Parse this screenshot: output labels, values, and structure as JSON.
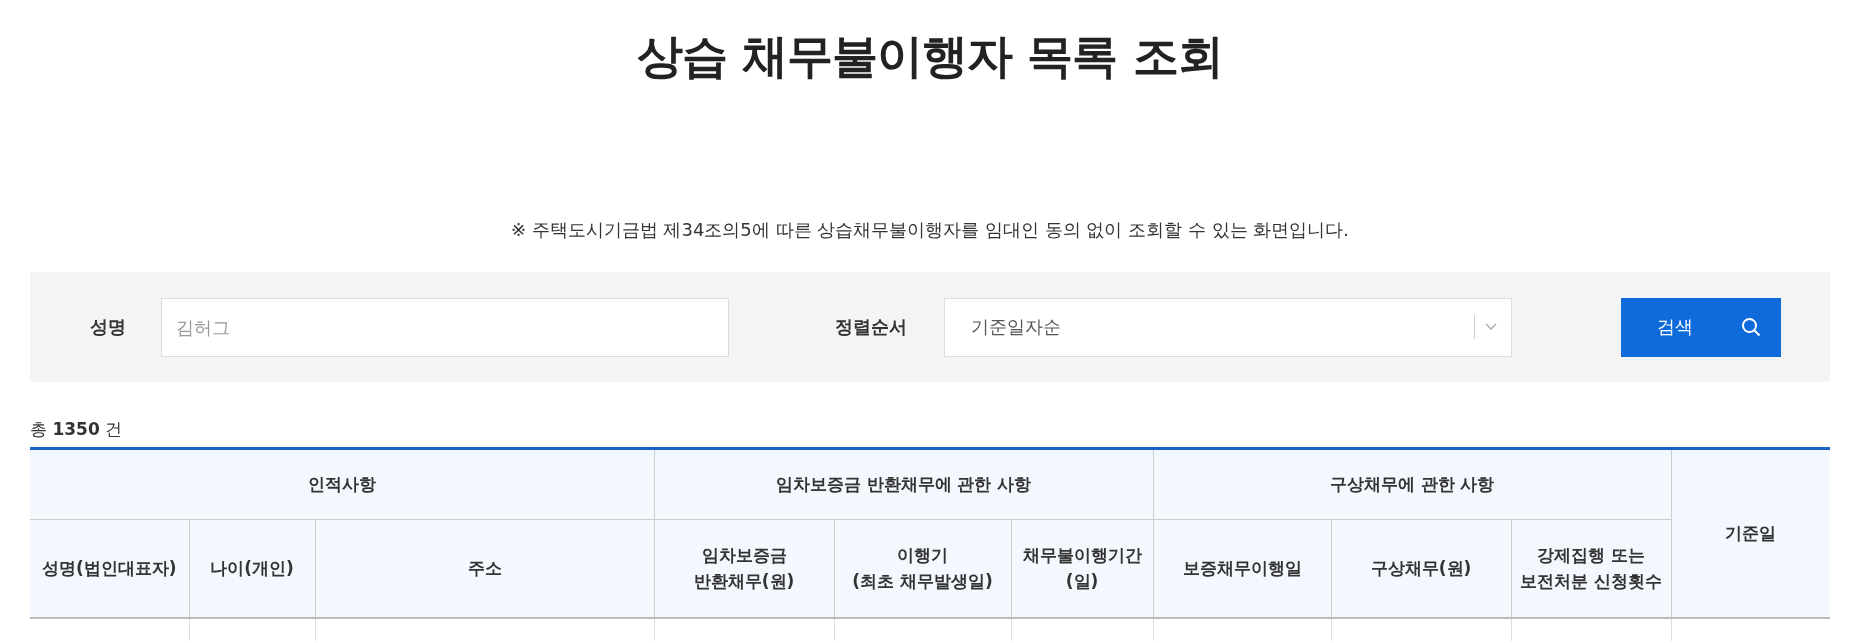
{
  "title": "상습 채무불이행자 목록 조회",
  "notice": "※ 주택도시기금법 제34조의5에 따른 상습채무불이행자를 임대인 동의 없이 조회할 수 있는 화면입니다.",
  "search": {
    "name_label": "성명",
    "name_placeholder": "김허그",
    "sort_label": "정렬순서",
    "sort_value": "기준일자순",
    "button": "검색"
  },
  "total": "총 **1350** 건",
  "table": {
    "groups": [
      {
        "label": "인적사항",
        "columns": [
          "성명(법인대표자)",
          "나이(개인)",
          "주소"
        ]
      },
      {
        "label": "임차보증금 반환채무에 관한 사항",
        "columns": [
          "임차보증금\n반환채무(원)",
          "이행기\n(최초 채무발생일)",
          "채무불이행기간\n(일)"
        ]
      },
      {
        "label": "구상채무에 관한 사항",
        "columns": [
          "보증채무이행일",
          "구상채무(원)",
          "강제집행 또는\n보전처분 신청횟수"
        ]
      },
      {
        "label": "기준일"
      }
    ]
  }
}
